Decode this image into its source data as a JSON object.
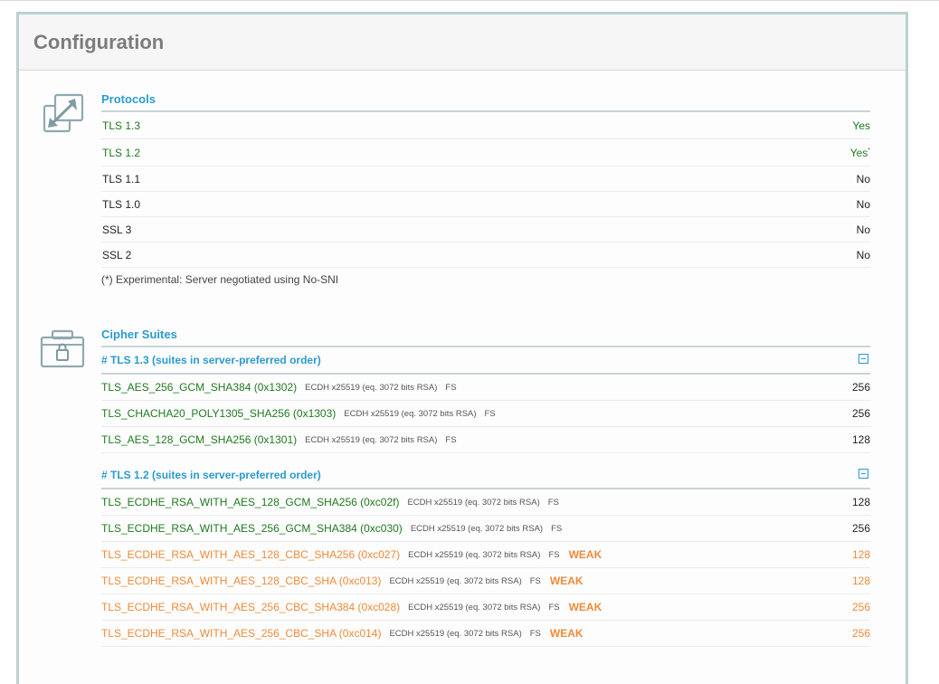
{
  "page": {
    "title": "Configuration"
  },
  "protocols": {
    "title": "Protocols",
    "rows": [
      {
        "name": "TLS 1.3",
        "value": "Yes",
        "supported": true,
        "note_mark": ""
      },
      {
        "name": "TLS 1.2",
        "value": "Yes",
        "supported": true,
        "note_mark": "*"
      },
      {
        "name": "TLS 1.1",
        "value": "No",
        "supported": false,
        "note_mark": ""
      },
      {
        "name": "TLS 1.0",
        "value": "No",
        "supported": false,
        "note_mark": ""
      },
      {
        "name": "SSL 3",
        "value": "No",
        "supported": false,
        "note_mark": ""
      },
      {
        "name": "SSL 2",
        "value": "No",
        "supported": false,
        "note_mark": ""
      }
    ],
    "footnote": "(*) Experimental: Server negotiated using No-SNI"
  },
  "cipher_suites": {
    "title": "Cipher Suites",
    "groups": [
      {
        "heading": "# TLS 1.3 (suites in server-preferred order)",
        "suites": [
          {
            "name": "TLS_AES_256_GCM_SHA384 (0x1302)",
            "kex": "ECDH x25519 (eq. 3072 bits RSA)",
            "fs": "FS",
            "weak": "",
            "bits": "256",
            "color": "#1f7a1f"
          },
          {
            "name": "TLS_CHACHA20_POLY1305_SHA256 (0x1303)",
            "kex": "ECDH x25519 (eq. 3072 bits RSA)",
            "fs": "FS",
            "weak": "",
            "bits": "256",
            "color": "#1f7a1f"
          },
          {
            "name": "TLS_AES_128_GCM_SHA256 (0x1301)",
            "kex": "ECDH x25519 (eq. 3072 bits RSA)",
            "fs": "FS",
            "weak": "",
            "bits": "128",
            "color": "#1f7a1f"
          }
        ]
      },
      {
        "heading": "# TLS 1.2 (suites in server-preferred order)",
        "suites": [
          {
            "name": "TLS_ECDHE_RSA_WITH_AES_128_GCM_SHA256 (0xc02f)",
            "kex": "ECDH x25519 (eq. 3072 bits RSA)",
            "fs": "FS",
            "weak": "",
            "bits": "128",
            "color": "#1f7a1f"
          },
          {
            "name": "TLS_ECDHE_RSA_WITH_AES_256_GCM_SHA384 (0xc030)",
            "kex": "ECDH x25519 (eq. 3072 bits RSA)",
            "fs": "FS",
            "weak": "",
            "bits": "256",
            "color": "#1f7a1f"
          },
          {
            "name": "TLS_ECDHE_RSA_WITH_AES_128_CBC_SHA256 (0xc027)",
            "kex": "ECDH x25519 (eq. 3072 bits RSA)",
            "fs": "FS",
            "weak": "WEAK",
            "bits": "128",
            "color": "#f08a3a"
          },
          {
            "name": "TLS_ECDHE_RSA_WITH_AES_128_CBC_SHA (0xc013)",
            "kex": "ECDH x25519 (eq. 3072 bits RSA)",
            "fs": "FS",
            "weak": "WEAK",
            "bits": "128",
            "color": "#f08a3a"
          },
          {
            "name": "TLS_ECDHE_RSA_WITH_AES_256_CBC_SHA384 (0xc028)",
            "kex": "ECDH x25519 (eq. 3072 bits RSA)",
            "fs": "FS",
            "weak": "WEAK",
            "bits": "256",
            "color": "#f08a3a"
          },
          {
            "name": "TLS_ECDHE_RSA_WITH_AES_256_CBC_SHA (0xc014)",
            "kex": "ECDH x25519 (eq. 3072 bits RSA)",
            "fs": "FS",
            "weak": "WEAK",
            "bits": "256",
            "color": "#f08a3a"
          }
        ]
      }
    ]
  },
  "colors": {
    "accent": "#2a9bd0",
    "good": "#1f7a1f",
    "weak": "#f08a3a",
    "frame_border": "#bcd0cf"
  },
  "icons": {
    "protocols": "expand-arrows-icon",
    "cipher_suites": "lock-toolbox-icon",
    "group_toggle": "collapse-minus-icon"
  }
}
